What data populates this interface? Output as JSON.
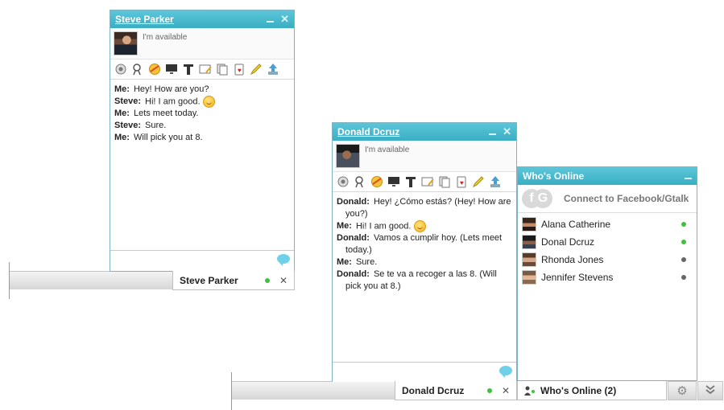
{
  "chat_windows": [
    {
      "title": "Steve Parker",
      "status": "I'm available",
      "tab_label": "Steve Parker",
      "messages": [
        {
          "who": "Me:",
          "text": "Hey! How are you?"
        },
        {
          "who": "Steve:",
          "text": "Hi! I am good."
        },
        {
          "who": "Me:",
          "text": "Lets meet today."
        },
        {
          "who": "Steve:",
          "text": "Sure."
        },
        {
          "who": "Me:",
          "text": "Will pick you at 8."
        }
      ]
    },
    {
      "title": "Donald Dcruz",
      "status": "I'm available",
      "tab_label": "Donald Dcruz",
      "messages": [
        {
          "who": "Donald:",
          "text": "Hey! ¿Cómo estás? (Hey! How are you?)"
        },
        {
          "who": "Me:",
          "text": "Hi! I am good."
        },
        {
          "who": "Donald:",
          "text": "Vamos a cumplir hoy. (Lets meet today.)"
        },
        {
          "who": "Me:",
          "text": "Sure."
        },
        {
          "who": "Donald:",
          "text": "Se te va a recoger a las 8. (Will pick you at 8.)"
        }
      ]
    }
  ],
  "whos_online": {
    "title": "Who's Online",
    "connect_label": "Connect to Facebook/Gtalk",
    "tab_label": "Who's Online (2)",
    "buddies": [
      {
        "name": "Alana Catherine",
        "status": "online"
      },
      {
        "name": "Donal Dcruz",
        "status": "online"
      },
      {
        "name": "Rhonda Jones",
        "status": "offline"
      },
      {
        "name": "Jennifer Stevens",
        "status": "offline"
      }
    ]
  },
  "toolbar_icons": [
    "webcam-icon",
    "video-call-icon",
    "smiley-icon",
    "screen-share-icon",
    "text-format-icon",
    "whiteboard-icon",
    "clipboard-icon",
    "cards-icon",
    "pencil-icon",
    "upload-icon"
  ],
  "colors": {
    "header": "#3aaec4",
    "online": "#3ec23e",
    "offline": "#666666"
  }
}
